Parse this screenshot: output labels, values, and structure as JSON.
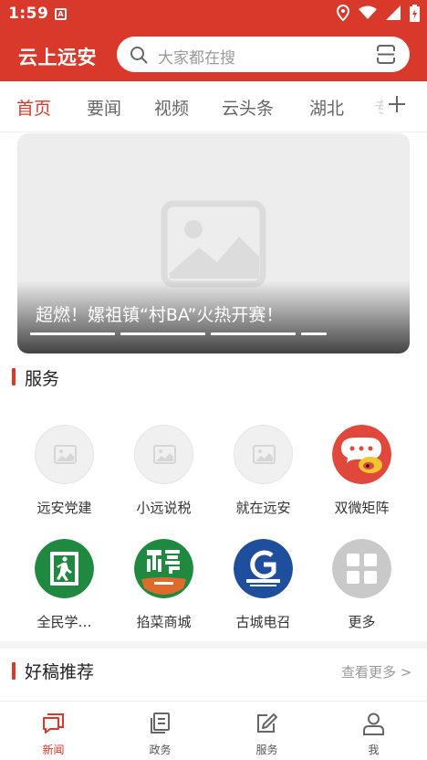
{
  "status_bar": {
    "time": "1:59",
    "notification_icon": "A"
  },
  "header": {
    "app_title": "云上远安",
    "search_placeholder": "大家都在搜"
  },
  "tabs": [
    {
      "label": "首页",
      "active": true
    },
    {
      "label": "要闻",
      "active": false
    },
    {
      "label": "视频",
      "active": false
    },
    {
      "label": "云头条",
      "active": false
    },
    {
      "label": "湖北",
      "active": false
    }
  ],
  "tab_partial": "专",
  "banner": {
    "caption": "超燃！嫘祖镇“村BA”火热开赛！",
    "slide_count": 5,
    "active_slide": 1
  },
  "services": {
    "title": "服务",
    "items": [
      {
        "label": "远安党建",
        "icon": "image-placeholder-icon"
      },
      {
        "label": "小远说税",
        "icon": "image-placeholder-icon"
      },
      {
        "label": "就在远安",
        "icon": "image-placeholder-icon"
      },
      {
        "label": "双微矩阵",
        "icon": "weibo-icon"
      },
      {
        "label": "全民学…",
        "icon": "emergency-exit-icon"
      },
      {
        "label": "掐菜商城",
        "icon": "qiacai-logo-icon"
      },
      {
        "label": "古城电召",
        "icon": "gucheng-dianzhao-logo-icon"
      },
      {
        "label": "更多",
        "icon": "grid-more-icon"
      }
    ]
  },
  "recommend": {
    "title": "好稿推荐",
    "more": "查看更多 >"
  },
  "bottom_nav": [
    {
      "label": "新闻",
      "icon": "news-chat-icon",
      "active": true
    },
    {
      "label": "政务",
      "icon": "document-icon",
      "active": false
    },
    {
      "label": "服务",
      "icon": "edit-icon",
      "active": false
    },
    {
      "label": "我",
      "icon": "user-icon",
      "active": false
    }
  ],
  "colors": {
    "brand_red": "#d8392b",
    "weibo_red": "#e0483b",
    "qiacai_green": "#1f8a3f",
    "gucheng_blue": "#1f4f9c",
    "more_gray": "#c9c9c9"
  }
}
